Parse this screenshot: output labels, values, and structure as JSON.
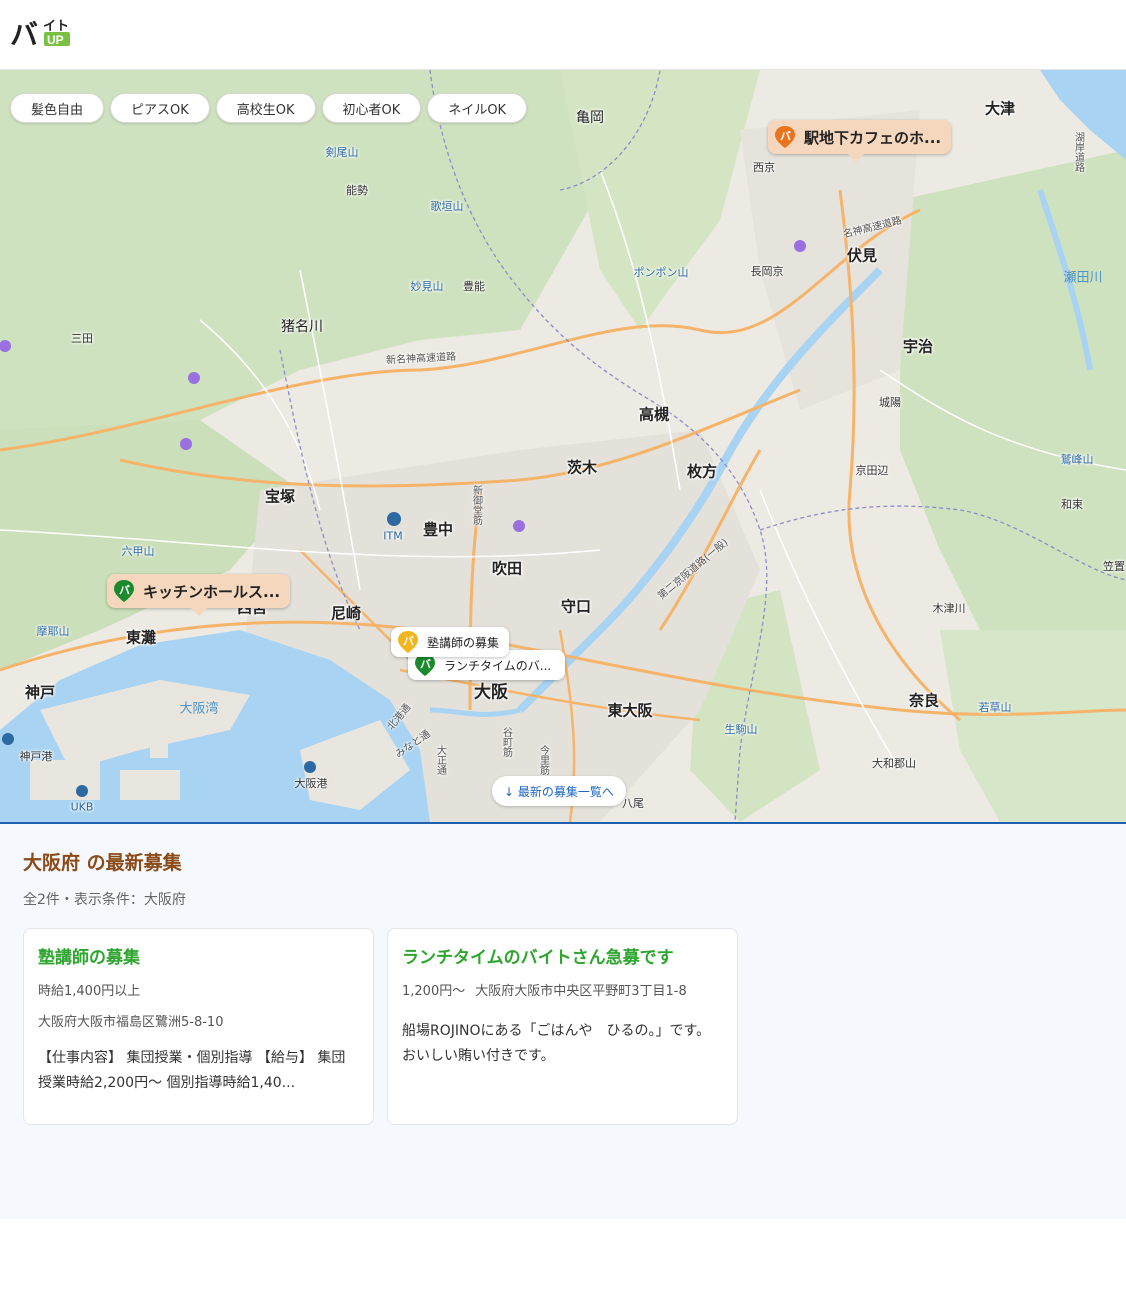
{
  "header": {
    "logo_text": "バイト",
    "logo_badge": "UP"
  },
  "filters": [
    "髪色自由",
    "ピアスOK",
    "高校生OK",
    "初心者OK",
    "ネイルOK"
  ],
  "map": {
    "labels": {
      "kameoka": "亀岡",
      "otsu": "大津",
      "nishikyo": "西京",
      "fushimi": "伏見",
      "nagaokakyo": "長岡京",
      "uji": "宇治",
      "joyo": "城陽",
      "kyotanabe": "京田辺",
      "takatsuki": "高槻",
      "ibaraki": "茨木",
      "hirakata": "枚方",
      "toyonaka": "豊中",
      "suita": "吹田",
      "moriguchi": "守口",
      "takarazuka": "宝塚",
      "amagasaki": "尼崎",
      "nishinomiya": "西宮",
      "higashinada": "東灘",
      "kobe": "神戸",
      "osaka": "大阪",
      "higashiosaka": "東大阪",
      "nara": "奈良",
      "yamatokoriyama": "大和郡山",
      "kizugawa": "木津川",
      "sanda": "三田",
      "inagawa": "猪名川",
      "nose": "能勢",
      "toyono": "豊能",
      "yao": "八尾",
      "kenbisan": "剣尾山",
      "utagakiyama": "歌垣山",
      "myokensan": "妙見山",
      "ponponzan": "ポンポン山",
      "rokkosan": "六甲山",
      "makayasan": "摩耶山",
      "ikomayama": "生駒山",
      "wakakusayama": "若草山",
      "shiramine": "鷲峰山",
      "wazuka": "和束",
      "kasagi": "笠置",
      "setagawa": "瀬田川",
      "osakawan": "大阪湾",
      "osakako": "大阪港",
      "kobeko": "神戸港",
      "itm": "ITM",
      "ukb": "UKB",
      "meishin": "名神高速道路",
      "shinmeishin": "新名神高速道路",
      "daini_keihan": "第二京阪道路(一般)",
      "shinmido": "新御堂筋",
      "hokko": "北港通",
      "minato": "みなと通",
      "taisho": "大正通",
      "tanimachi": "谷町筋",
      "imazato": "今里筋",
      "konanlake": "湖岸道路"
    },
    "markers": [
      {
        "label": "駅地下カフェのホ...",
        "pin_color": "#e8741e"
      },
      {
        "label": "キッチンホールス...",
        "pin_color": "#1b8a2c"
      },
      {
        "label": "塾講師の募集",
        "pin_color": "#f2b51d"
      },
      {
        "label": "ランチタイムのバ...",
        "pin_color": "#1b8a2c"
      }
    ],
    "latest_button": "↓ 最新の募集一覧へ"
  },
  "listing": {
    "title": "大阪府 の最新募集",
    "meta": "全2件・表示条件：大阪府",
    "cards": [
      {
        "title": "塾講師の募集",
        "wage": "時給1,400円以上",
        "address": "大阪府大阪市福島区鷺洲5-8-10",
        "description": "【仕事内容】 集団授業・個別指導 【給与】 集団授業時給2,200円～ 個別指導時給1,40..."
      },
      {
        "title": "ランチタイムのバイトさん急募です",
        "wage": "1,200円～",
        "address": "大阪府大阪市中央区平野町3丁目1-8",
        "description": "船場ROJINOにある「ごはんや　ひるの。」です。 おいしい賄い付きです。"
      }
    ]
  },
  "colors": {
    "accent_brown": "#8b4a17",
    "accent_green": "#2ea52e",
    "link_blue": "#1a66c2"
  }
}
